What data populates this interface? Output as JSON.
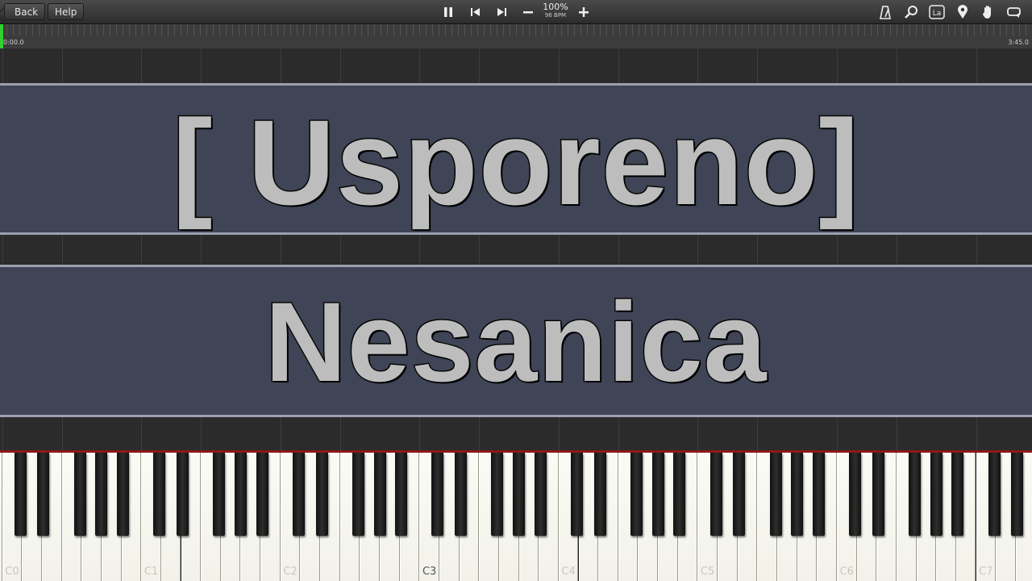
{
  "toolbar": {
    "back_label": "Back",
    "help_label": "Help",
    "speed_percent": "100%",
    "tempo": "96 BPM",
    "icons": [
      "pause-icon",
      "skip-back-icon",
      "skip-forward-icon",
      "minus-icon",
      "plus-icon",
      "metronome-icon",
      "magnifier-icon",
      "label-icon",
      "location-pin-icon",
      "hand-icon",
      "loop-icon"
    ],
    "label_icon_text": "La"
  },
  "timeline": {
    "start_time": "0:00.0",
    "end_time": "3:45.0",
    "progress_fraction": 0.0
  },
  "banners": {
    "line1": "[ Usporeno]",
    "line2": "Nesanica"
  },
  "keyboard": {
    "octave_labels": [
      "C0",
      "C1",
      "C2",
      "C3",
      "C4",
      "C5",
      "C6",
      "C7"
    ],
    "colors": {
      "white_key": "#f8f8f0",
      "black_key": "#1a1a1a",
      "banner_bg": "#3f4556",
      "accent_red": "#8b1a1a",
      "progress_green": "#31d030"
    }
  }
}
